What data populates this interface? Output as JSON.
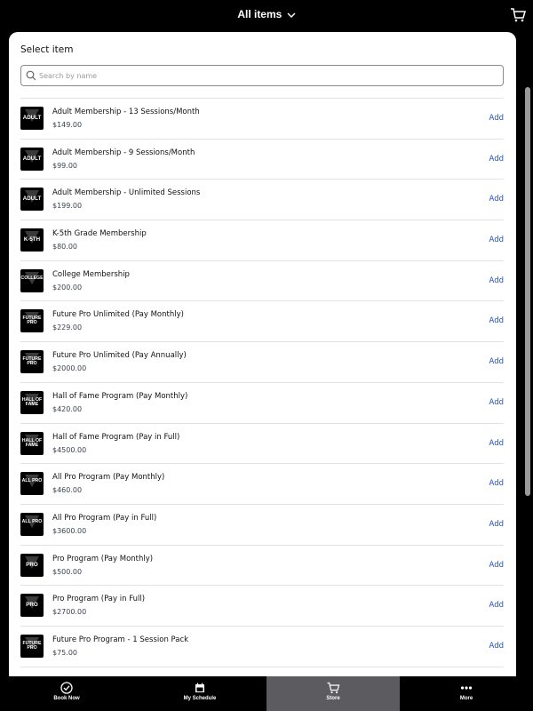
{
  "header": {
    "title": "All items"
  },
  "sheet": {
    "title": "Select item"
  },
  "search": {
    "placeholder": "Search by name"
  },
  "items": [
    {
      "name": "Adult Membership - 13 Sessions/Month",
      "price": "$149.00",
      "thumb": "ADULT",
      "add": "Add"
    },
    {
      "name": "Adult Membership - 9 Sessions/Month",
      "price": "$99.00",
      "thumb": "ADULT",
      "add": "Add"
    },
    {
      "name": "Adult Membership - Unlimited Sessions",
      "price": "$199.00",
      "thumb": "ADULT",
      "add": "Add"
    },
    {
      "name": "K-5th Grade Membership",
      "price": "$80.00",
      "thumb": "K-5TH",
      "add": "Add"
    },
    {
      "name": "College Membership",
      "price": "$200.00",
      "thumb": "COLLEGE",
      "add": "Add"
    },
    {
      "name": "Future Pro Unlimited (Pay Monthly)",
      "price": "$229.00",
      "thumb": "FUTURE\nPRO",
      "add": "Add"
    },
    {
      "name": "Future Pro Unlimited (Pay Annually)",
      "price": "$2000.00",
      "thumb": "FUTURE\nPRO",
      "add": "Add"
    },
    {
      "name": "Hall of Fame Program (Pay Monthly)",
      "price": "$420.00",
      "thumb": "HALL OF\nFAME",
      "add": "Add"
    },
    {
      "name": "Hall of Fame Program (Pay in Full)",
      "price": "$4500.00",
      "thumb": "HALL OF\nFAME",
      "add": "Add"
    },
    {
      "name": "All Pro Program (Pay Monthly)",
      "price": "$460.00",
      "thumb": "ALL PRO",
      "add": "Add"
    },
    {
      "name": "All Pro Program (Pay in Full)",
      "price": "$3600.00",
      "thumb": "ALL PRO",
      "add": "Add"
    },
    {
      "name": "Pro Program (Pay Monthly)",
      "price": "$500.00",
      "thumb": "PRO",
      "add": "Add"
    },
    {
      "name": "Pro Program (Pay in Full)",
      "price": "$2700.00",
      "thumb": "PRO",
      "add": "Add"
    },
    {
      "name": "Future Pro Program - 1 Session Pack",
      "price": "$75.00",
      "thumb": "FUTURE\nPRO",
      "add": "Add"
    }
  ],
  "nav": [
    {
      "label": "Book Now",
      "icon": "check-circle-icon",
      "active": false
    },
    {
      "label": "My Schedule",
      "icon": "calendar-icon",
      "active": false
    },
    {
      "label": "Store",
      "icon": "cart-icon",
      "active": true
    },
    {
      "label": "More",
      "icon": "more-dots-icon",
      "active": false
    }
  ],
  "colors": {
    "accent": "#1f4fbf",
    "active_tab": "#5c5c60",
    "bar": "#000000"
  }
}
